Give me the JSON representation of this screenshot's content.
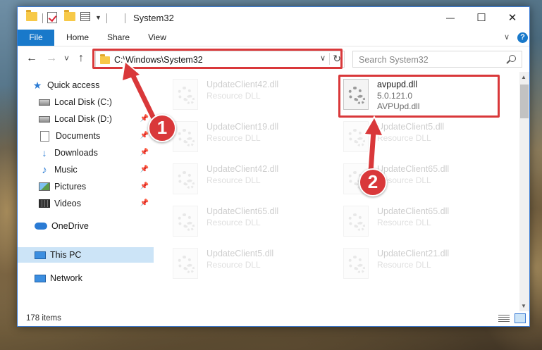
{
  "window": {
    "title": "System32",
    "minimize": "—",
    "maximize": "☐",
    "close": "✕"
  },
  "ribbon": {
    "tabs": [
      "File",
      "Home",
      "Share",
      "View"
    ],
    "help": "?",
    "collapse": "∨"
  },
  "nav": {
    "back": "←",
    "forward": "→",
    "recent": "˅",
    "up": "↑",
    "address": "C:\\Windows\\System32",
    "address_dropdown": "∨",
    "refresh": "↻",
    "search_placeholder": "Search System32"
  },
  "sidebar": {
    "items": [
      {
        "label": "Quick access",
        "icon": "star-icon"
      },
      {
        "label": "Local Disk (C:)",
        "icon": "drive-icon",
        "pinned": true
      },
      {
        "label": "Local Disk (D:)",
        "icon": "drive-icon",
        "pinned": true
      },
      {
        "label": "Documents",
        "icon": "documents-icon",
        "pinned": true
      },
      {
        "label": "Downloads",
        "icon": "downloads-icon",
        "pinned": true
      },
      {
        "label": "Music",
        "icon": "music-icon",
        "pinned": true
      },
      {
        "label": "Pictures",
        "icon": "pictures-icon",
        "pinned": true
      },
      {
        "label": "Videos",
        "icon": "videos-icon",
        "pinned": true
      },
      {
        "label": "OneDrive",
        "icon": "onedrive-icon"
      },
      {
        "label": "This PC",
        "icon": "this-pc-icon",
        "selected": true
      },
      {
        "label": "Network",
        "icon": "network-icon"
      }
    ]
  },
  "files": [
    {
      "name": "UpdateClient42.dll",
      "line2": "Resource DLL",
      "line3": "",
      "faded": true
    },
    {
      "name": "avpupd.dll",
      "line2": "5.0.121.0",
      "line3": "AVPUpd.dll",
      "faded": false
    },
    {
      "name": "UpdateClient19.dll",
      "line2": "Resource DLL",
      "line3": "",
      "faded": true
    },
    {
      "name": "UpdateClient5.dll",
      "line2": "Resource DLL",
      "line3": "",
      "faded": true
    },
    {
      "name": "UpdateClient42.dll",
      "line2": "Resource DLL",
      "line3": "",
      "faded": true
    },
    {
      "name": "UpdateClient65.dll",
      "line2": "Resource DLL",
      "line3": "",
      "faded": true
    },
    {
      "name": "UpdateClient65.dll",
      "line2": "Resource DLL",
      "line3": "",
      "faded": true
    },
    {
      "name": "UpdateClient65.dll",
      "line2": "Resource DLL",
      "line3": "",
      "faded": true
    },
    {
      "name": "UpdateClient5.dll",
      "line2": "Resource DLL",
      "line3": "",
      "faded": true
    },
    {
      "name": "UpdateClient21.dll",
      "line2": "Resource DLL",
      "line3": "",
      "faded": true
    }
  ],
  "status": {
    "item_count": "178 items"
  },
  "annotations": {
    "badge1": "1",
    "badge2": "2",
    "color": "#d9383a"
  }
}
